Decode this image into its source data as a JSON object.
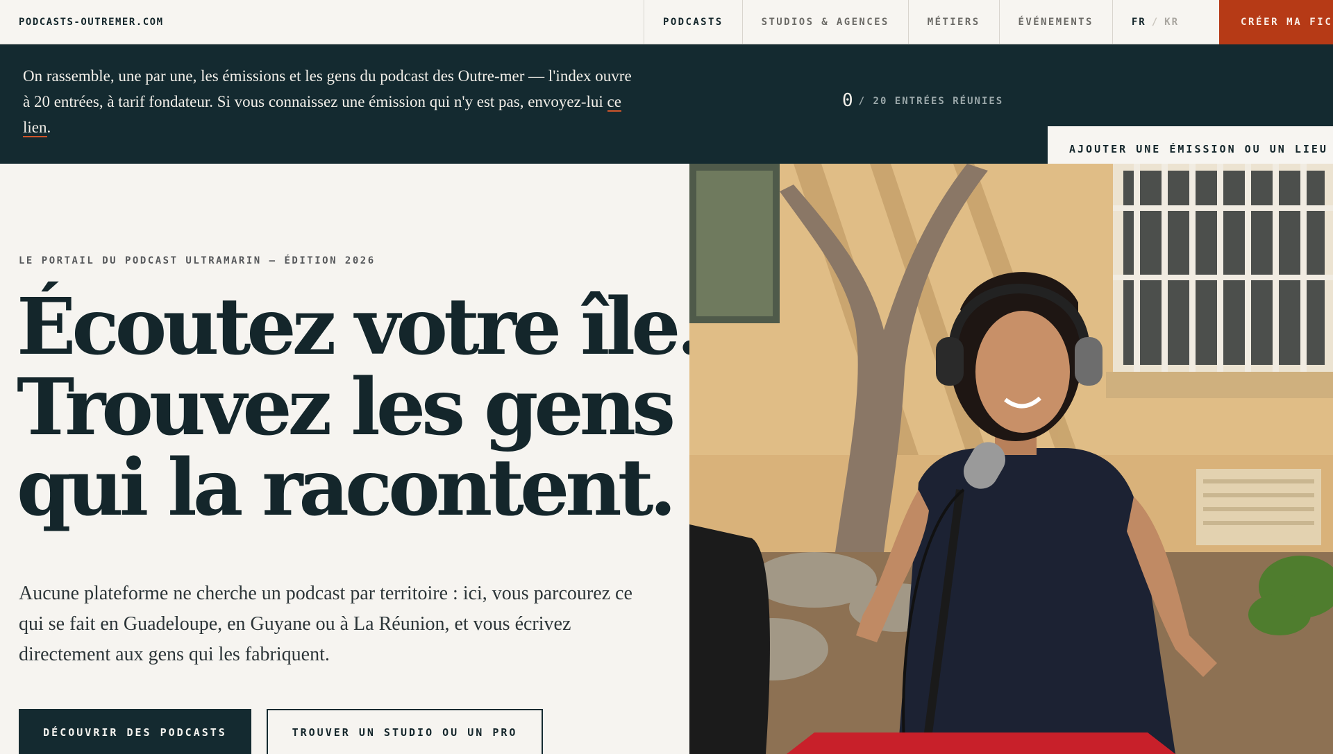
{
  "header": {
    "brand": "PODCASTS-OUTREMER.COM",
    "nav": [
      "PODCASTS",
      "STUDIOS & AGENCES",
      "MÉTIERS",
      "ÉVÉNEMENTS"
    ],
    "lang_active": "FR",
    "lang_sep": "/",
    "lang_other": "KR",
    "cta": "CRÉER MA FICHE"
  },
  "banner": {
    "text_before": "On rassemble, une par une, les émissions et les gens du podcast des Outre-mer — l'index ouvre à 20 entrées, à tarif fondateur. Si vous connaissez une émission qui n'y est pas, envoyez-lui ",
    "link": "ce lien",
    "text_after": ".",
    "count": "0",
    "count_label": "/ 20 ENTRÉES RÉUNIES",
    "add_button": "AJOUTER UNE ÉMISSION OU UN LIEU"
  },
  "hero": {
    "eyebrow": "LE PORTAIL DU PODCAST ULTRAMARIN — ÉDITION 2026",
    "headline": [
      "Écoutez votre île.",
      "Trouvez les gens",
      "qui la racontent."
    ],
    "lede": "Aucune plateforme ne cherche un podcast par territoire : ici, vous parcourez ce qui se fait en Guadeloupe, en Guyane ou à La Réunion, et vous écrivez directement aux gens qui les fabriquent.",
    "primary_button": "DÉCOUVRIR DES PODCASTS",
    "secondary_button": "TROUVER UN STUDIO OU UN PRO"
  },
  "colors": {
    "accent": "#b63a16",
    "dark": "#142a30",
    "background": "#f6f4f0"
  }
}
